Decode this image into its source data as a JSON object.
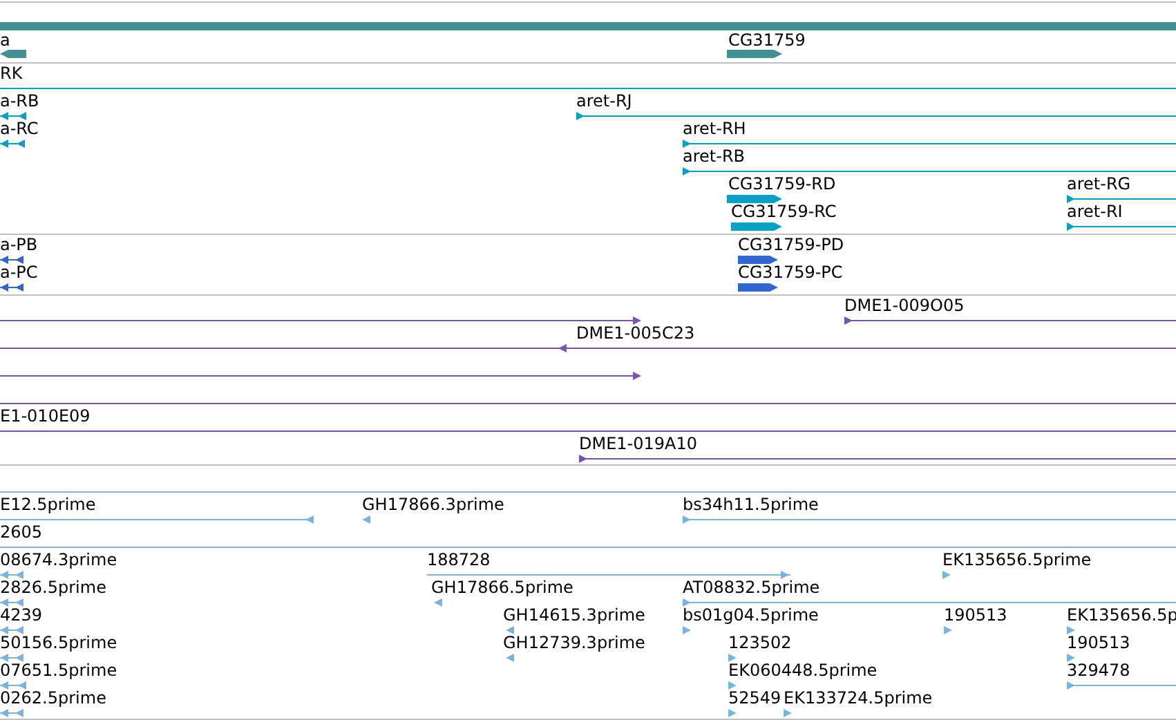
{
  "tracks": [
    {
      "kind": "gene",
      "features": [
        {
          "label": "a",
          "kind": "bar",
          "reverse": true
        },
        {
          "label": "CG31759",
          "kind": "bar",
          "reverse": false
        }
      ]
    },
    {
      "kind": "transcript",
      "features": [
        {
          "label": "RK",
          "kind": "line"
        },
        {
          "label": "a-RB",
          "kind": "stub",
          "reverse": true
        },
        {
          "label": "a-RC",
          "kind": "stub",
          "reverse": true
        },
        {
          "label": "aret-RJ",
          "kind": "line",
          "reverse": false
        },
        {
          "label": "aret-RH",
          "kind": "line",
          "reverse": false
        },
        {
          "label": "aret-RB",
          "kind": "line",
          "reverse": false
        },
        {
          "label": "CG31759-RD",
          "kind": "bar",
          "reverse": false
        },
        {
          "label": "aret-RG",
          "kind": "line",
          "reverse": false
        },
        {
          "label": "CG31759-RC",
          "kind": "bar",
          "reverse": false
        },
        {
          "label": "aret-RI",
          "kind": "line",
          "reverse": false
        }
      ]
    },
    {
      "kind": "protein",
      "features": [
        {
          "label": "a-PB",
          "kind": "stub",
          "reverse": true
        },
        {
          "label": "a-PC",
          "kind": "stub",
          "reverse": true
        },
        {
          "label": "CG31759-PD",
          "kind": "bar",
          "reverse": false
        },
        {
          "label": "CG31759-PC",
          "kind": "bar",
          "reverse": false
        }
      ]
    },
    {
      "kind": "clone",
      "features": [
        {
          "kind": "line",
          "reverse": false
        },
        {
          "label": "DME1-009O05",
          "kind": "line",
          "reverse": false
        },
        {
          "label": "DME1-005C23",
          "kind": "line",
          "reverse": true
        },
        {
          "kind": "line",
          "reverse": false
        },
        {
          "kind": "line"
        },
        {
          "label": "E1-010E09",
          "kind": "line"
        },
        {
          "label": "DME1-019A10",
          "kind": "line",
          "reverse": false
        }
      ]
    },
    {
      "kind": "est",
      "features": [
        {
          "kind": "line"
        },
        {
          "label": "E12.5prime",
          "kind": "line",
          "reverse": true
        },
        {
          "label": "GH17866.3prime",
          "kind": "tick",
          "reverse": true
        },
        {
          "label": "bs34h11.5prime",
          "kind": "line",
          "reverse": false
        },
        {
          "label": "2605",
          "kind": "line"
        },
        {
          "label": "08674.3prime",
          "kind": "stub",
          "reverse": true
        },
        {
          "label": "188728",
          "kind": "line",
          "reverse": false
        },
        {
          "label": "EK135656.5prime",
          "kind": "tick",
          "reverse": false
        },
        {
          "label": "2826.5prime",
          "kind": "stub",
          "reverse": true
        },
        {
          "label": "GH17866.5prime",
          "kind": "tick",
          "reverse": true
        },
        {
          "label": "AT08832.5prime",
          "kind": "line",
          "reverse": false
        },
        {
          "label": "4239",
          "kind": "stub",
          "reverse": true
        },
        {
          "label": "GH14615.3prime",
          "kind": "tick",
          "reverse": true
        },
        {
          "label": "bs01g04.5prime",
          "kind": "tick",
          "reverse": false
        },
        {
          "label": "190513",
          "kind": "tick",
          "reverse": false
        },
        {
          "label": "EK135656.5p",
          "kind": "tick",
          "reverse": false
        },
        {
          "label": "50156.5prime",
          "kind": "stub",
          "reverse": true
        },
        {
          "label": "GH12739.3prime",
          "kind": "tick",
          "reverse": true
        },
        {
          "label": "123502",
          "kind": "tick",
          "reverse": false
        },
        {
          "label": "190513",
          "kind": "tick",
          "reverse": false
        },
        {
          "label": "07651.5prime",
          "kind": "stub",
          "reverse": true
        },
        {
          "label": "EK060448.5prime",
          "kind": "tick",
          "reverse": false
        },
        {
          "label": "329478",
          "kind": "line",
          "reverse": false
        },
        {
          "label": "0262.5prime",
          "kind": "stub",
          "reverse": true
        },
        {
          "label": "52549",
          "kind": "tick",
          "reverse": false
        },
        {
          "label": "EK133724.5prime",
          "kind": "tick",
          "reverse": false
        }
      ]
    }
  ]
}
